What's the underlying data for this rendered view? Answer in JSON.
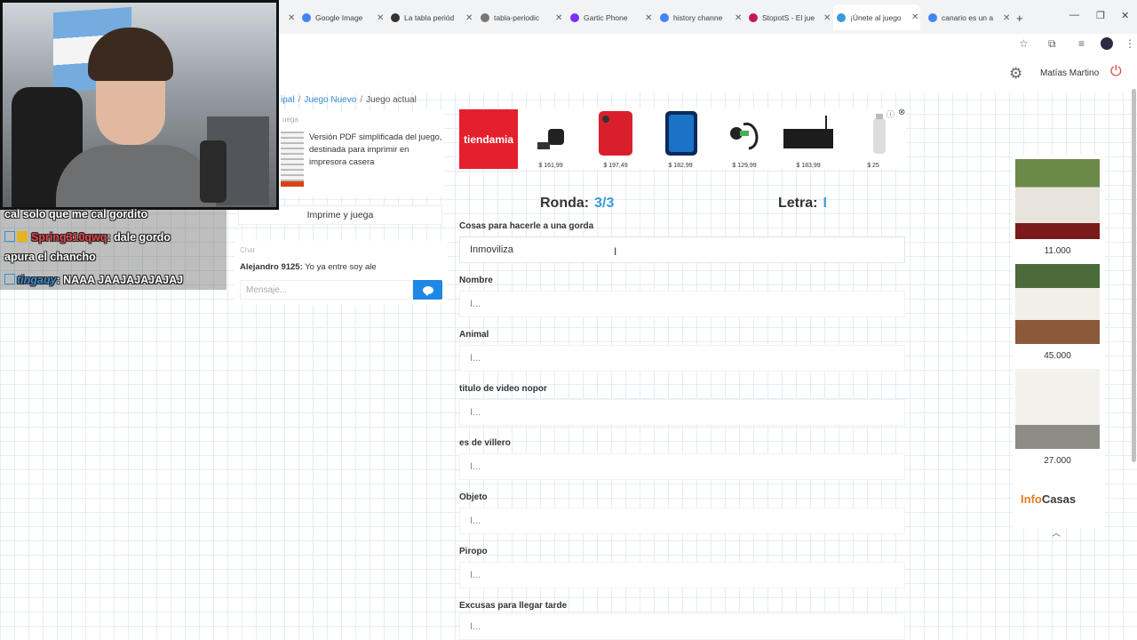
{
  "browser": {
    "tabs": [
      {
        "label": "Google Image",
        "color": "#4285f4"
      },
      {
        "label": "La tabla periód",
        "color": "#333333"
      },
      {
        "label": "tabla-periodic",
        "color": "#555555"
      },
      {
        "label": "Gartic Phone",
        "color": "#7b2ff7"
      },
      {
        "label": "history channe",
        "color": "#4285f4"
      },
      {
        "label": "StopotS - El jue",
        "color": "#c2185b"
      },
      {
        "label": "¡Únete al juego",
        "color": "#3a9ad9"
      },
      {
        "label": "canario es un a",
        "color": "#4285f4"
      }
    ],
    "new_tab": "+"
  },
  "header": {
    "username": "Matías Martino"
  },
  "breadcrumb": {
    "items": [
      "ipal",
      "Juego Nuevo",
      "Juego actual"
    ]
  },
  "print_card": {
    "heading": "uega",
    "description": "Versión PDF simplificada del juego, destinada para imprimir en impresora casera",
    "button": "Imprime y juega"
  },
  "chat": {
    "title": "Chat",
    "message_user": "Alejandro 9125:",
    "message_text": " Yo ya entre soy ale",
    "input_placeholder": "Mensaje..."
  },
  "ad": {
    "brand": "tiendamia",
    "prices": [
      "$ 161,99",
      "$ 197,49",
      "$ 182,99",
      "$ 129,99",
      "$ 183,99",
      "$ 25"
    ]
  },
  "game": {
    "round_label": "Ronda:",
    "round_value": "3/3",
    "letter_label": "Letra:",
    "letter_value": "I",
    "categories": [
      {
        "label": "Cosas para hacerle a una gorda",
        "value": "Inmoviliza",
        "placeholder": "I..."
      },
      {
        "label": "Nombre",
        "value": "",
        "placeholder": "I..."
      },
      {
        "label": "Animal",
        "value": "",
        "placeholder": "I..."
      },
      {
        "label": "titulo de video nopor",
        "value": "",
        "placeholder": "I..."
      },
      {
        "label": "es de villero",
        "value": "",
        "placeholder": "I..."
      },
      {
        "label": "Objeto",
        "value": "",
        "placeholder": "I..."
      },
      {
        "label": "Piropo",
        "value": "",
        "placeholder": "I..."
      },
      {
        "label": "Excusas para llegar tarde",
        "value": "",
        "placeholder": "I..."
      }
    ]
  },
  "right_ad": {
    "prices": [
      "11.000",
      "45.000",
      "27.000"
    ],
    "brand_part1": "Info",
    "brand_part2": "Casas"
  },
  "stream_chat": {
    "line0": "cal solo que me cal gordito",
    "line1_user": "Spring310qwq",
    "line1_text": ": dale gordo",
    "line2": "apura el chancho",
    "line3_user": "tingauy",
    "line3_text": ": NAAA JAAJAJAJAJAJ"
  }
}
